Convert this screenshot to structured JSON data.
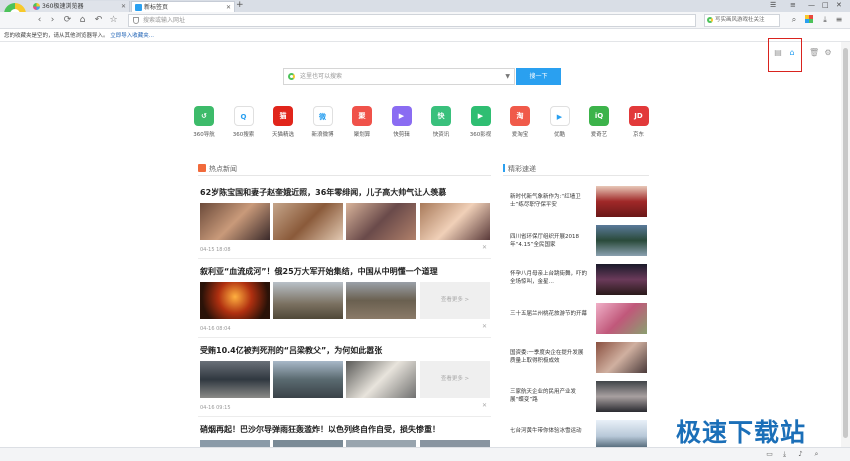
{
  "tabs": [
    {
      "label": "360极速浏览器",
      "active": false
    },
    {
      "label": "新标签页",
      "active": true
    }
  ],
  "address": {
    "placeholder": "搜索或输入网址"
  },
  "topsearch": {
    "placeholder": "写实画风游戏社关注"
  },
  "favbar": {
    "notice": "您的收藏夹是空的，请从其他浏览器导入。",
    "link": "立即导入收藏夹..."
  },
  "pagesearch": {
    "placeholder": "这里也可以搜索",
    "button": "搜一下"
  },
  "apps": [
    {
      "label": "360导航",
      "icon": "360-nav-icon",
      "text": "↺",
      "color": "#3dbb6a"
    },
    {
      "label": "360搜索",
      "icon": "360-search-icon",
      "text": "Q",
      "color": "#ffffff"
    },
    {
      "label": "天猫精选",
      "icon": "tmall-icon",
      "text": "猫",
      "color": "#e1251b"
    },
    {
      "label": "新浪微博",
      "icon": "weibo-icon",
      "text": "微",
      "color": "#ffffff"
    },
    {
      "label": "聚划算",
      "icon": "juhuasuan-icon",
      "text": "聚",
      "color": "#f0524a"
    },
    {
      "label": "快剪辑",
      "icon": "kuaijianji-icon",
      "text": "▶",
      "color": "#8a6cf2"
    },
    {
      "label": "快资讯",
      "icon": "kuaizixun-icon",
      "text": "快",
      "color": "#39c07c"
    },
    {
      "label": "360影视",
      "icon": "360-video-icon",
      "text": "▶",
      "color": "#2fbe72"
    },
    {
      "label": "爱淘宝",
      "icon": "aitaobao-icon",
      "text": "淘",
      "color": "#f05a4a"
    },
    {
      "label": "优酷",
      "icon": "youku-icon",
      "text": "▶",
      "color": "#ffffff"
    },
    {
      "label": "爱奇艺",
      "icon": "iqiyi-icon",
      "text": "iQ",
      "color": "#3cb34a"
    },
    {
      "label": "京东",
      "icon": "jd-icon",
      "text": "JD",
      "color": "#e2393a"
    }
  ],
  "news": {
    "heading": "热点新闻",
    "more_label": "查看更多 >",
    "items": [
      {
        "title": "62岁陈宝国和妻子赵奎娥近照，36年零绯闻，儿子高大帅气让人羡慕",
        "meta": "04-15 18:08",
        "has_more": false
      },
      {
        "title": "叙利亚“血流成河”！俄25万大军开始集结，中国从中明懂一个道理",
        "meta": "04-16 08:04",
        "has_more": true
      },
      {
        "title": "受贿10.4亿被判死刑的“吕梁教父”，为何如此嚣张",
        "meta": "04-16 09:15",
        "has_more": true
      },
      {
        "title": "硝烟再起！巴沙尔导弹雨狂轰滥炸！以色列终自作自受，损失惨重！",
        "meta": "",
        "has_more": false
      }
    ]
  },
  "picks": {
    "heading": "精彩速递",
    "items": [
      "新时代新气象新作为:“红墙卫士”练尽职守保平安",
      "四川省环保厅组织开展2018年“4.15”全民国家",
      "怀孕八月母亲上台跳街舞，吓的全场惊叫，金星…",
      "三十五届兰州桃花旅游节的开幕",
      "国资委:一季度央企在提升发展质量上取得积极成效",
      "三家航天企业的民用产业发展“蝶变”路",
      "七台河黄牛带你体验冰雪运动"
    ]
  },
  "watermark": "极速下载站"
}
